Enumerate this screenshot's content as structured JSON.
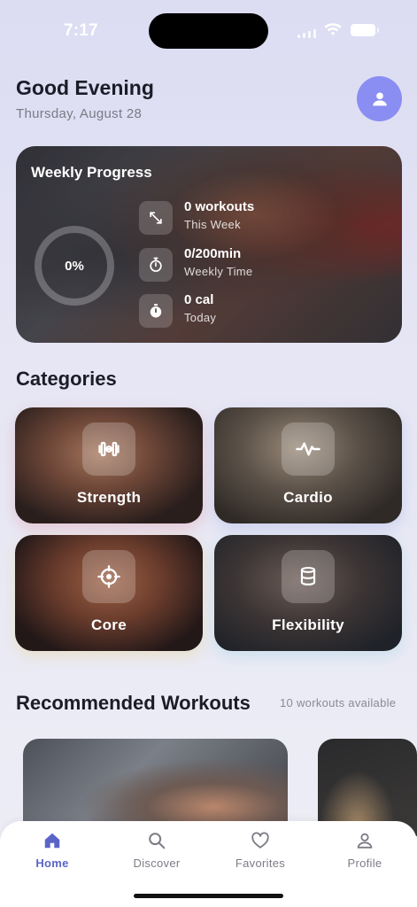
{
  "status": {
    "time": "7:17"
  },
  "header": {
    "greeting": "Good Evening",
    "date": "Thursday, August 28"
  },
  "progress_card": {
    "title": "Weekly Progress",
    "percent_label": "0%",
    "percent": 0,
    "stats": [
      {
        "value": "0 workouts",
        "label": "This Week",
        "icon": "arrows-diagonal-icon"
      },
      {
        "value": "0/200min",
        "label": "Weekly Time",
        "icon": "stopwatch-icon"
      },
      {
        "value": "0 cal",
        "label": "Today",
        "icon": "timer-icon"
      }
    ]
  },
  "categories": {
    "title": "Categories",
    "items": [
      {
        "name": "Strength",
        "icon": "dumbbell-icon"
      },
      {
        "name": "Cardio",
        "icon": "heartbeat-icon"
      },
      {
        "name": "Core",
        "icon": "crosshair-icon"
      },
      {
        "name": "Flexibility",
        "icon": "cylinder-icon"
      }
    ]
  },
  "recommended": {
    "title": "Recommended Workouts",
    "available": "10 workouts available"
  },
  "tabbar": {
    "items": [
      {
        "label": "Home",
        "icon": "home-icon",
        "active": true
      },
      {
        "label": "Discover",
        "icon": "search-icon",
        "active": false
      },
      {
        "label": "Favorites",
        "icon": "heart-icon",
        "active": false
      },
      {
        "label": "Profile",
        "icon": "person-icon",
        "active": false
      }
    ]
  },
  "colors": {
    "accent": "#5a64c8",
    "avatar": "#8a8ef2",
    "background": "#e4e4f4"
  }
}
